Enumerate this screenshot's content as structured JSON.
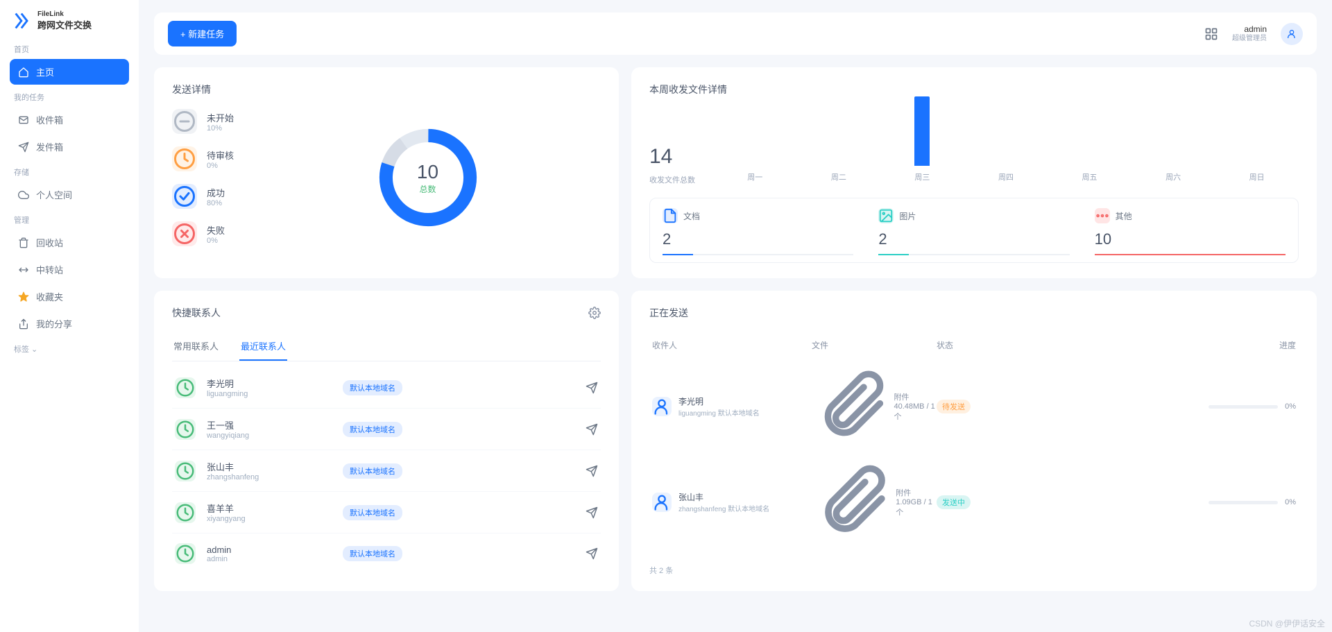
{
  "brand": {
    "name": "FileLink",
    "tagline": "跨网文件交换"
  },
  "sidebar": {
    "groups": [
      {
        "title": "首页",
        "items": [
          {
            "label": "主页",
            "icon": "home",
            "active": true
          }
        ]
      },
      {
        "title": "我的任务",
        "items": [
          {
            "label": "收件箱",
            "icon": "mail"
          },
          {
            "label": "发件箱",
            "icon": "send"
          }
        ]
      },
      {
        "title": "存储",
        "items": [
          {
            "label": "个人空间",
            "icon": "cloud"
          }
        ]
      },
      {
        "title": "管理",
        "items": [
          {
            "label": "回收站",
            "icon": "trash"
          },
          {
            "label": "中转站",
            "icon": "transfer"
          },
          {
            "label": "收藏夹",
            "icon": "star",
            "fav": true
          },
          {
            "label": "我的分享",
            "icon": "share"
          }
        ]
      },
      {
        "title": "标签 ⌄",
        "items": []
      }
    ]
  },
  "topbar": {
    "new_task": "+ 新建任务",
    "user": {
      "name": "admin",
      "role": "超级管理员"
    }
  },
  "send_details": {
    "title": "发送详情",
    "statuses": [
      {
        "label": "未开始",
        "pct": "10%",
        "cls": "si-gray",
        "icon": "minus"
      },
      {
        "label": "待审核",
        "pct": "0%",
        "cls": "si-orange",
        "icon": "clock"
      },
      {
        "label": "成功",
        "pct": "80%",
        "cls": "si-blue",
        "icon": "check"
      },
      {
        "label": "失败",
        "pct": "0%",
        "cls": "si-red",
        "icon": "x"
      }
    ],
    "total": {
      "num": "10",
      "label": "总数"
    },
    "chart_data": {
      "type": "pie",
      "title": "发送详情",
      "series": [
        {
          "name": "未开始",
          "value": 10
        },
        {
          "name": "待审核",
          "value": 0
        },
        {
          "name": "成功",
          "value": 80
        },
        {
          "name": "失败",
          "value": 0
        },
        {
          "name": "其他",
          "value": 10
        }
      ]
    }
  },
  "week": {
    "title": "本周收发文件详情",
    "total": "14",
    "total_label": "收发文件总数",
    "chart_data": {
      "type": "bar",
      "categories": [
        "周一",
        "周二",
        "周三",
        "周四",
        "周五",
        "周六",
        "周日"
      ],
      "values": [
        0,
        0,
        14,
        0,
        0,
        0,
        0
      ],
      "ylim": [
        0,
        14
      ]
    },
    "types": [
      {
        "label": "文档",
        "count": "2",
        "cls": "ti-blue",
        "fill": "fill-blue"
      },
      {
        "label": "图片",
        "count": "2",
        "cls": "ti-cyan",
        "fill": "fill-cyan"
      },
      {
        "label": "其他",
        "count": "10",
        "cls": "ti-red",
        "fill": "fill-red"
      }
    ]
  },
  "contacts": {
    "title": "快捷联系人",
    "tabs": [
      {
        "label": "常用联系人",
        "active": false
      },
      {
        "label": "最近联系人",
        "active": true
      }
    ],
    "domain_badge": "默认本地域名",
    "list": [
      {
        "name": "李光明",
        "user": "liguangming"
      },
      {
        "name": "王一强",
        "user": "wangyiqiang"
      },
      {
        "name": "张山丰",
        "user": "zhangshanfeng"
      },
      {
        "name": "喜羊羊",
        "user": "xiyangyang"
      },
      {
        "name": "admin",
        "user": "admin"
      }
    ]
  },
  "sending": {
    "title": "正在发送",
    "columns": {
      "recipient": "收件人",
      "file": "文件",
      "status": "状态",
      "progress": "进度"
    },
    "rows": [
      {
        "name": "李光明",
        "user": "liguangming",
        "domain": "默认本地域名",
        "file": "附件 40.48MB / 1 个",
        "status": "待发送",
        "status_cls": "sb-orange",
        "pct": "0%"
      },
      {
        "name": "张山丰",
        "user": "zhangshanfeng",
        "domain": "默认本地域名",
        "file": "附件 1.09GB / 1 个",
        "status": "发送中",
        "status_cls": "sb-cyan",
        "pct": "0%"
      }
    ],
    "total": "共 2 条"
  },
  "watermark": "CSDN @伊伊话安全"
}
